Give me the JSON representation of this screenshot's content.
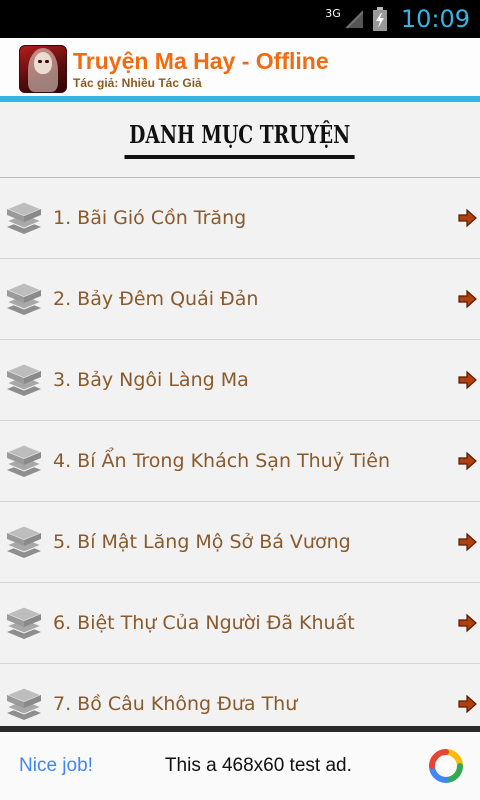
{
  "status_bar": {
    "network": "3G",
    "time": "10:09"
  },
  "header": {
    "title": "Truyện Ma Hay - Offline",
    "subtitle": "Tác giả: Nhiều Tác Giả",
    "accent_color": "#33b5e5",
    "title_color": "#f26b10"
  },
  "section": {
    "heading": "DANH MỤC TRUYỆN"
  },
  "stories": [
    {
      "label": "1. Bãi Gió Cồn Trăng"
    },
    {
      "label": "2. Bảy Đêm Quái Đản"
    },
    {
      "label": "3. Bảy Ngôi Làng Ma"
    },
    {
      "label": "4. Bí Ẩn Trong Khách Sạn Thuỷ Tiên"
    },
    {
      "label": "5. Bí Mật Lăng Mộ Sở Bá Vương"
    },
    {
      "label": "6. Biệt Thự Của Người Đã Khuất"
    },
    {
      "label": "7. Bồ Câu Không Đưa Thư"
    }
  ],
  "ad": {
    "left_text": "Nice job!",
    "center_text": "This a 468x60 test ad."
  },
  "icons": {
    "list_item": "layers-icon",
    "list_arrow": "arrow-right-icon",
    "ad": "ad-choices-icon"
  }
}
